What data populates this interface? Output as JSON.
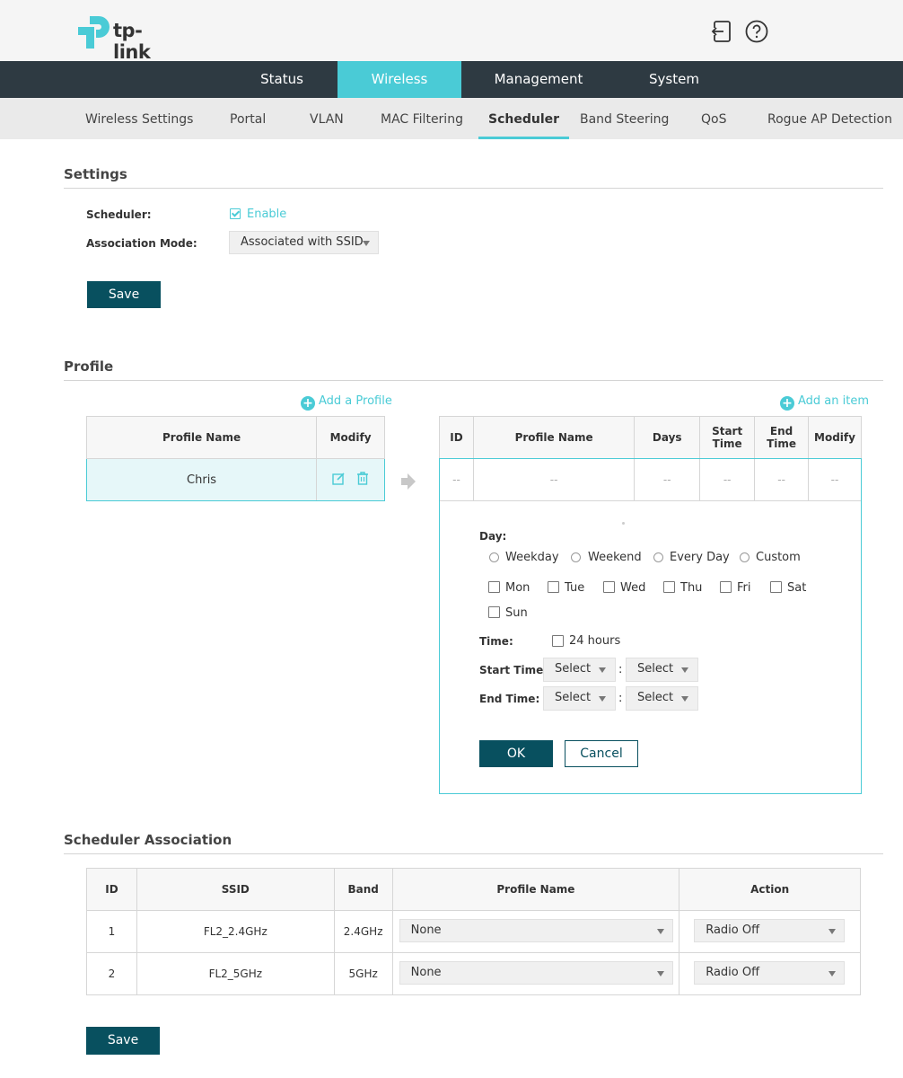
{
  "header": {
    "brand": "tp-link",
    "icons": {
      "logout": "logout-icon",
      "help": "help-icon"
    }
  },
  "main_nav": [
    {
      "label": "Status",
      "active": false
    },
    {
      "label": "Wireless",
      "active": true
    },
    {
      "label": "Management",
      "active": false
    },
    {
      "label": "System",
      "active": false
    }
  ],
  "sub_nav": [
    {
      "label": "Wireless Settings",
      "active": false
    },
    {
      "label": "Portal",
      "active": false
    },
    {
      "label": "VLAN",
      "active": false
    },
    {
      "label": "MAC Filtering",
      "active": false
    },
    {
      "label": "Scheduler",
      "active": true
    },
    {
      "label": "Band Steering",
      "active": false
    },
    {
      "label": "QoS",
      "active": false
    },
    {
      "label": "Rogue AP Detection",
      "active": false
    }
  ],
  "settings": {
    "title": "Settings",
    "scheduler_label": "Scheduler:",
    "enable_label": "Enable",
    "enable_checked": true,
    "assoc_mode_label": "Association Mode:",
    "assoc_mode_value": "Associated with SSID",
    "save_label": "Save"
  },
  "profile": {
    "title": "Profile",
    "add_profile_label": "Add a Profile",
    "add_item_label": "Add an item",
    "profiles_table": {
      "headers": [
        "Profile Name",
        "Modify"
      ],
      "rows": [
        {
          "name": "Chris"
        }
      ]
    },
    "items_table": {
      "headers": [
        "ID",
        "Profile Name",
        "Days",
        "Start Time",
        "End Time",
        "Modify"
      ],
      "rows": [
        [
          "--",
          "--",
          "--",
          "--",
          "--",
          "--"
        ]
      ]
    },
    "editor": {
      "day_label": "Day:",
      "day_options": [
        "Weekday",
        "Weekend",
        "Every Day",
        "Custom"
      ],
      "weekdays": [
        "Mon",
        "Tue",
        "Wed",
        "Thu",
        "Fri",
        "Sat",
        "Sun"
      ],
      "time_label": "Time:",
      "all_day_label": "24 hours",
      "start_time_label": "Start Time:",
      "end_time_label": "End Time:",
      "select_placeholder": "Select",
      "time_separator": ":",
      "ok_label": "OK",
      "cancel_label": "Cancel"
    }
  },
  "association": {
    "title": "Scheduler Association",
    "headers": [
      "ID",
      "SSID",
      "Band",
      "Profile Name",
      "Action"
    ],
    "rows": [
      {
        "id": "1",
        "ssid": "FL2_2.4GHz",
        "band": "2.4GHz",
        "profile": "None",
        "action": "Radio Off"
      },
      {
        "id": "2",
        "ssid": "FL2_5GHz",
        "band": "5GHz",
        "profile": "None",
        "action": "Radio Off"
      }
    ],
    "save_label": "Save"
  },
  "colors": {
    "accent": "#4acbd6",
    "nav_bg": "#2e3a42",
    "button": "#08505f"
  }
}
